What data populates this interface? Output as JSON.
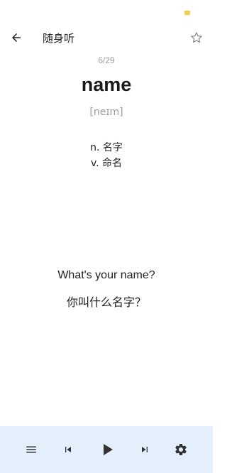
{
  "header": {
    "title": "随身听",
    "back_icon": "arrow-left-icon",
    "favorite_icon": "star-outline-icon"
  },
  "card": {
    "progress": "6/29",
    "word": "name",
    "phonetic": "[neɪm]",
    "definitions": [
      "n. 名字",
      "v. 命名"
    ],
    "example_en": "What's your name?",
    "example_zh": "你叫什么名字？"
  },
  "player": {
    "icons": [
      "menu-icon",
      "skip-previous-icon",
      "play-icon",
      "skip-next-icon",
      "settings-gear-icon"
    ]
  },
  "colors": {
    "accent_bar": "#e3f0fb",
    "text_primary": "#1a1a1a",
    "text_muted": "#9e9e9e",
    "battery": "#f2d04a"
  }
}
